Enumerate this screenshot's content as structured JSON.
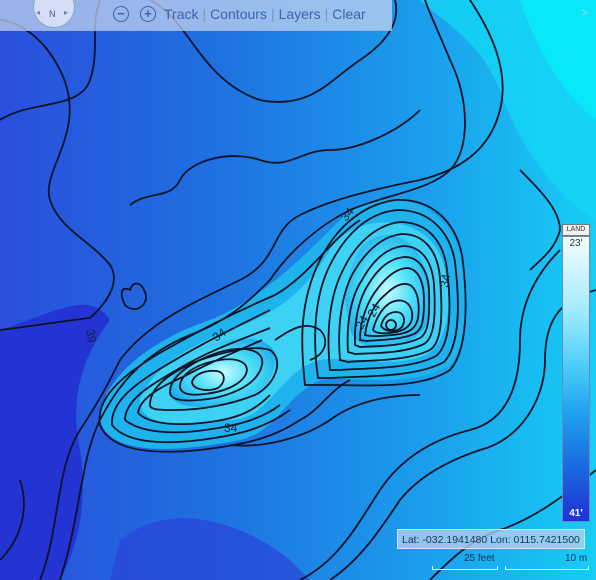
{
  "toolbar": {
    "compass_label": "N",
    "menu": {
      "track": "Track",
      "contours": "Contours",
      "layers": "Layers",
      "clear": "Clear",
      "separator": "|"
    },
    "collapse_label": ">"
  },
  "legend": {
    "land_label": "LAND",
    "top_value": "23'",
    "bottom_value": "41'"
  },
  "status": {
    "coordinates": "Lat: -032.1941480 Lon: 0115.7421500"
  },
  "scale": {
    "feet_label": "25 feet",
    "meters_label": "10 m"
  },
  "contour_labels": {
    "l1": "39",
    "l2": "34",
    "l3": "34",
    "l4": "34",
    "l5": "34",
    "l6": "24",
    "l7": "24"
  },
  "colors": {
    "deep": "#2232d6",
    "mid": "#1d86e5",
    "shallow": "#19d3f2",
    "shoal": "#79f0fb"
  }
}
